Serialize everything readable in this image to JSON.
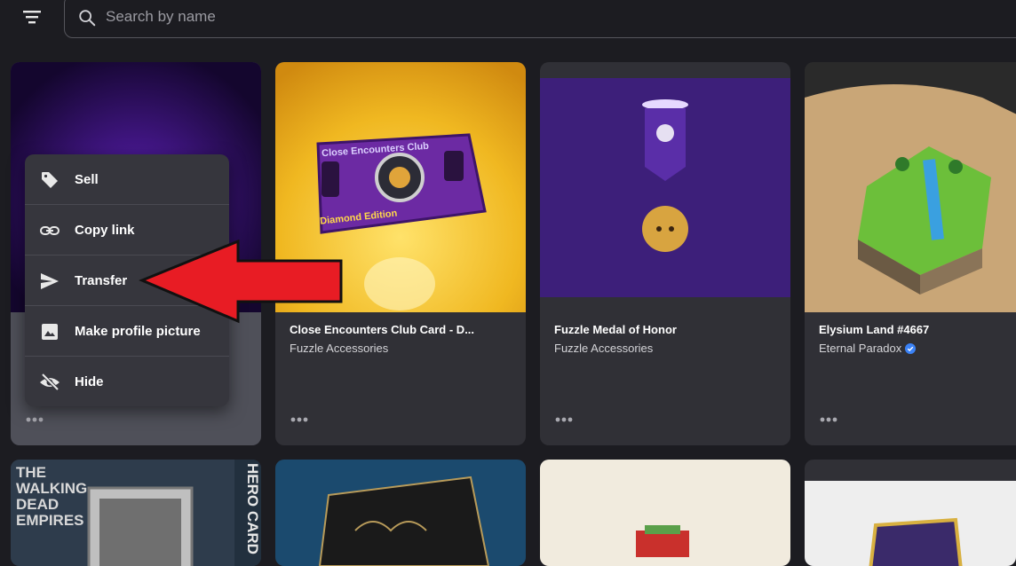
{
  "search": {
    "placeholder": "Search by name"
  },
  "cards": [
    {
      "title": "",
      "subtitle": ""
    },
    {
      "title": "Close Encounters Club Card - D...",
      "subtitle": "Fuzzle Accessories",
      "art_title": "Close Encounters Club",
      "art_edition": "Diamond Edition"
    },
    {
      "title": "Fuzzle Medal of Honor",
      "subtitle": "Fuzzle Accessories"
    },
    {
      "title": "Elysium Land #4667",
      "subtitle": "Eternal Paradox",
      "verified": true
    }
  ],
  "bottom_cards": [
    {
      "art_text_left": "THE WALKING DEAD EMPIRES",
      "art_text_right": "HERO CARD"
    },
    {},
    {},
    {}
  ],
  "context_menu": {
    "items": [
      {
        "label": "Sell",
        "icon": "tag-icon"
      },
      {
        "label": "Copy link",
        "icon": "link-icon"
      },
      {
        "label": "Transfer",
        "icon": "send-icon"
      },
      {
        "label": "Make profile picture",
        "icon": "image-icon"
      },
      {
        "label": "Hide",
        "icon": "eye-off-icon"
      }
    ]
  },
  "colors": {
    "accent_arrow": "#e81c24",
    "card_bg": "#303036",
    "page_bg": "#1c1c21",
    "verified": "#3b82f6"
  }
}
